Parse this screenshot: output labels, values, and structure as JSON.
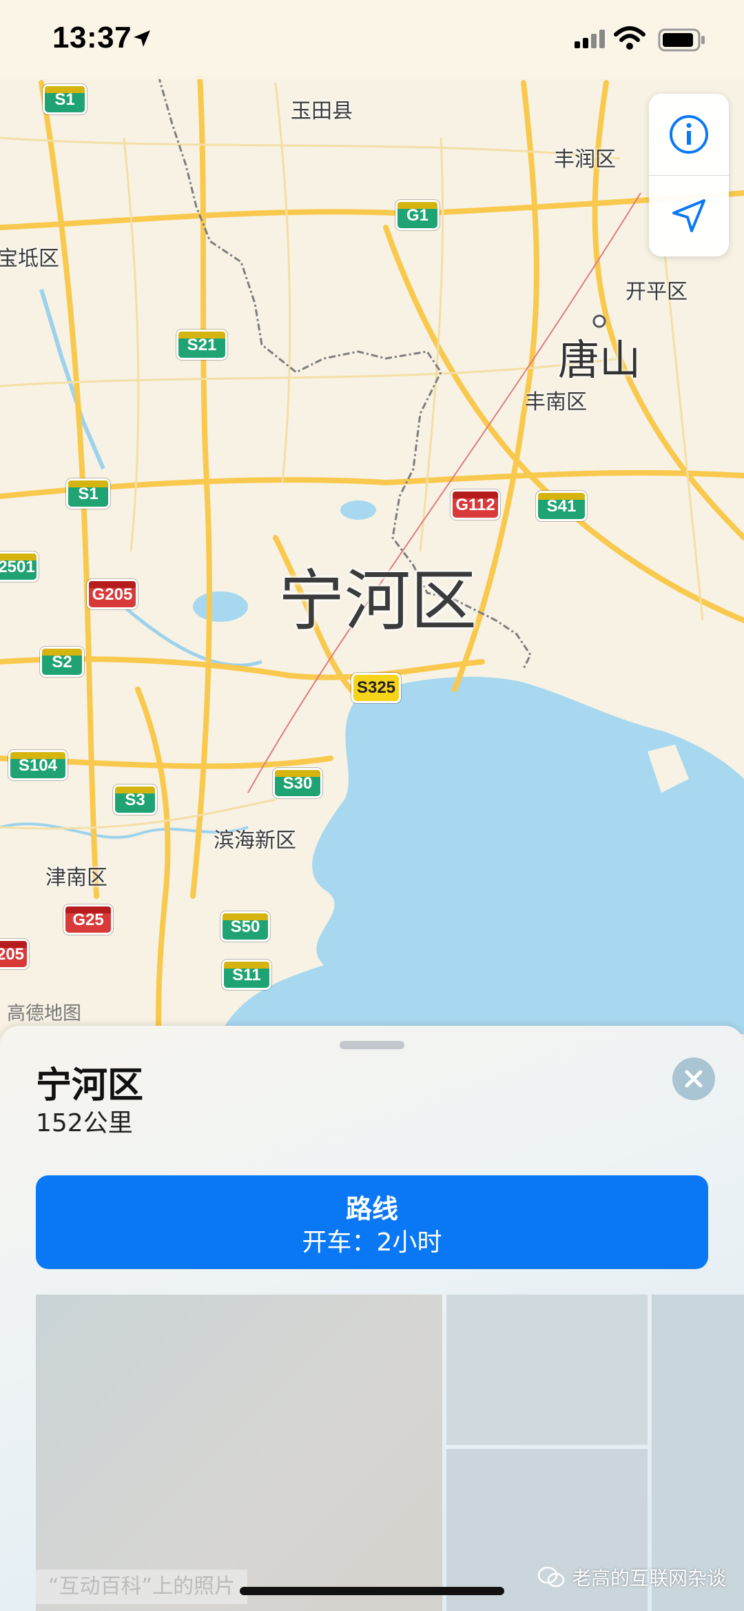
{
  "status_bar": {
    "time": "13:37"
  },
  "map": {
    "labels": {
      "yutian": "玉田县",
      "fengrun": "丰润区",
      "baodi": "宝坻区",
      "kaiping": "开平区",
      "tangshan": "唐山",
      "fengnan": "丰南区",
      "ninghe": "宁河区",
      "binhai": "滨海新区",
      "jinnan": "津南区"
    },
    "shields": {
      "s1_top": "S1",
      "g1": "G1",
      "s21": "S21",
      "s1_mid": "S1",
      "g112": "G112",
      "s41": "S41",
      "g2501": "2501",
      "g205": "G205",
      "s2": "S2",
      "s325": "S325",
      "s104": "S104",
      "s3": "S3",
      "s30": "S30",
      "g25": "G25",
      "s50": "S50",
      "s11": "S11",
      "g205_edge": "205"
    },
    "attribution": "高德地图",
    "colors": {
      "water": "#a8d8ef",
      "land": "#f7f2e4",
      "road": "#f9c94e"
    }
  },
  "sheet": {
    "title": "宁河区",
    "distance": "152公里",
    "route_button": {
      "title": "路线",
      "subtitle": "开车：2小时"
    },
    "photo_caption": "“互动百科”上的照片"
  },
  "watermark": "老高的互联网杂谈"
}
